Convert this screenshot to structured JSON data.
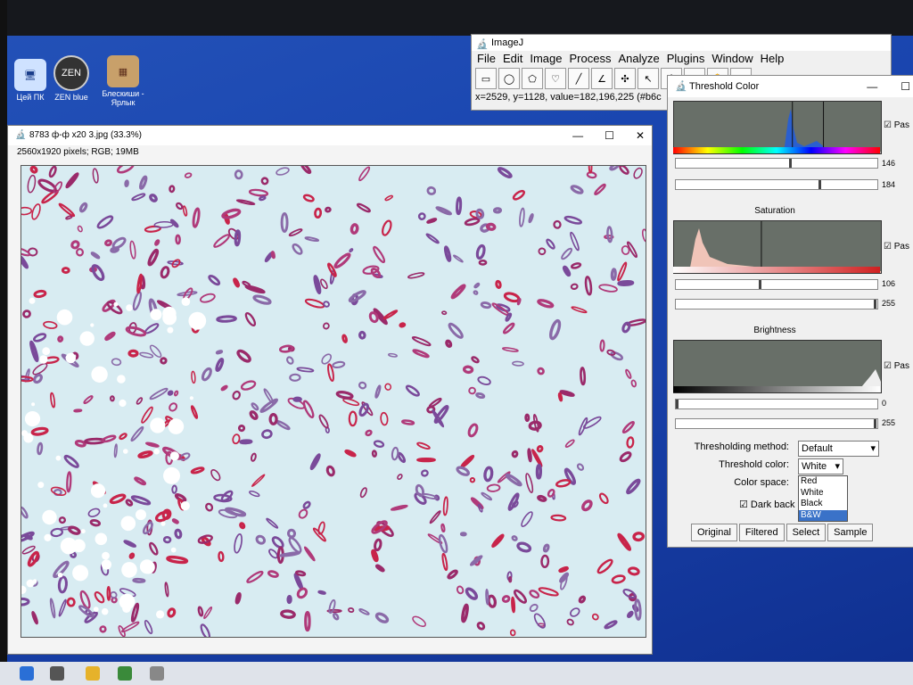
{
  "desktop_icons": [
    {
      "label": "Цей ПК",
      "icon": "computer-icon"
    },
    {
      "label": "ZEN blue",
      "icon": "zen-icon"
    },
    {
      "label": "Блескиши - Ярлык",
      "icon": "folder-image-icon"
    }
  ],
  "imagej": {
    "title": "ImageJ",
    "menu": [
      "File",
      "Edit",
      "Image",
      "Process",
      "Analyze",
      "Plugins",
      "Window",
      "Help"
    ],
    "status": "x=2529, y=1128, value=182,196,225 (#b6c"
  },
  "image_window": {
    "title": "8783 ф-ф x20 3.jpg (33.3%)",
    "info": "2560x1920 pixels; RGB; 19MB"
  },
  "threshold": {
    "title": "Threshold Color",
    "hue": {
      "min": 146,
      "max": 184,
      "min_frac": 0.57,
      "max_frac": 0.72,
      "pass_label": "Pas",
      "pass_checked": true
    },
    "saturation": {
      "label": "Saturation",
      "min": 106,
      "max": 255,
      "min_frac": 0.42,
      "max_frac": 1.0,
      "pass_label": "Pas",
      "pass_checked": true
    },
    "brightness": {
      "label": "Brightness",
      "min": 0,
      "max": 255,
      "min_frac": 0.0,
      "max_frac": 1.0,
      "pass_label": "Pas",
      "pass_checked": true
    },
    "method_label": "Thresholding method:",
    "method_value": "Default",
    "color_label": "Threshold color:",
    "color_value": "White",
    "colorspace_label": "Color space:",
    "dark_label": "Dark back",
    "dark_checked": true,
    "color_options": [
      "Red",
      "White",
      "Black",
      "B&W"
    ],
    "color_highlighted": "B&W",
    "buttons": [
      "Original",
      "Filtered",
      "Select",
      "Sample"
    ]
  },
  "colors": {
    "desktop": "#1a46b0",
    "tissue_magenta": "#9a2a6a",
    "tissue_red": "#c8244a",
    "tissue_bg": "#d8ecf2",
    "highlight": "#3a72c8"
  }
}
